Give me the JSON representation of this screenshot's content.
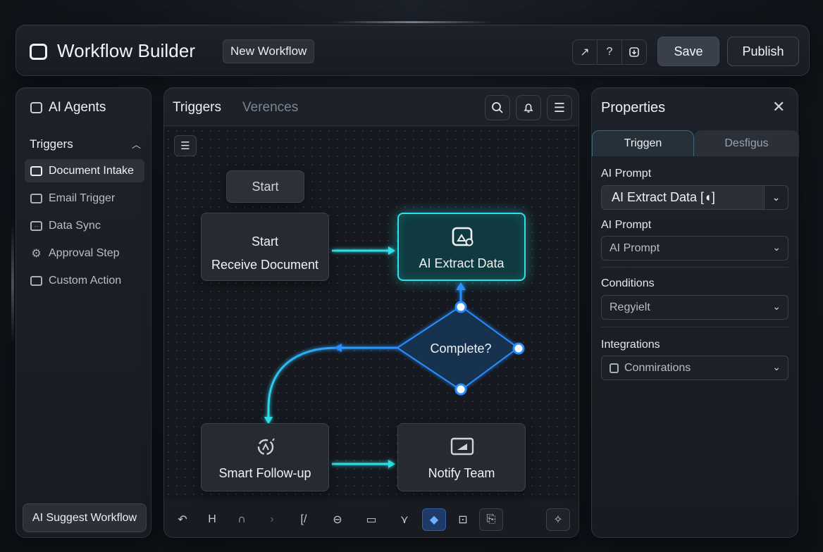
{
  "header": {
    "app_title": "Workflow Builder",
    "workflow_chip": "New Workflow",
    "icons": [
      "redo-icon",
      "help-icon",
      "download-icon"
    ],
    "icon_glyphs": [
      "↗",
      "?",
      "⍗"
    ],
    "save_label": "Save",
    "publish_label": "Publish"
  },
  "sidebar": {
    "title": "AI Agents",
    "section": "Triggers",
    "items": [
      {
        "label": "Document Intake",
        "active": true
      },
      {
        "label": "Email Trigger",
        "active": false
      },
      {
        "label": "Data Sync",
        "active": false
      },
      {
        "label": "Approval Step",
        "active": false
      },
      {
        "label": "Custom Action",
        "active": false
      }
    ],
    "suggest_button": "AI Suggest Workflow"
  },
  "canvas": {
    "tabs": [
      "Triggers",
      "Verences"
    ],
    "nodes": {
      "start_pill": "Start",
      "receive_line1": "Start",
      "receive_line2": "Receive Document",
      "ai_extract": "AI Extract Data",
      "decision": "Complete?",
      "followup": "Smart Follow-up",
      "notify": "Notify Team"
    },
    "accent": "#2fe0e6"
  },
  "properties": {
    "title": "Properties",
    "tabs": [
      "Triggen",
      "Desfigus"
    ],
    "ai_prompt_label_1": "AI Prompt",
    "ai_prompt_value_1": "AI Extract Data [◖]",
    "ai_prompt_label_2": "AI Prompt",
    "ai_prompt_value_2": "AI Prompt",
    "conditions_label": "Conditions",
    "conditions_value": "Regyielt",
    "integrations_label": "Integrations",
    "integrations_value": "Conmirations"
  }
}
